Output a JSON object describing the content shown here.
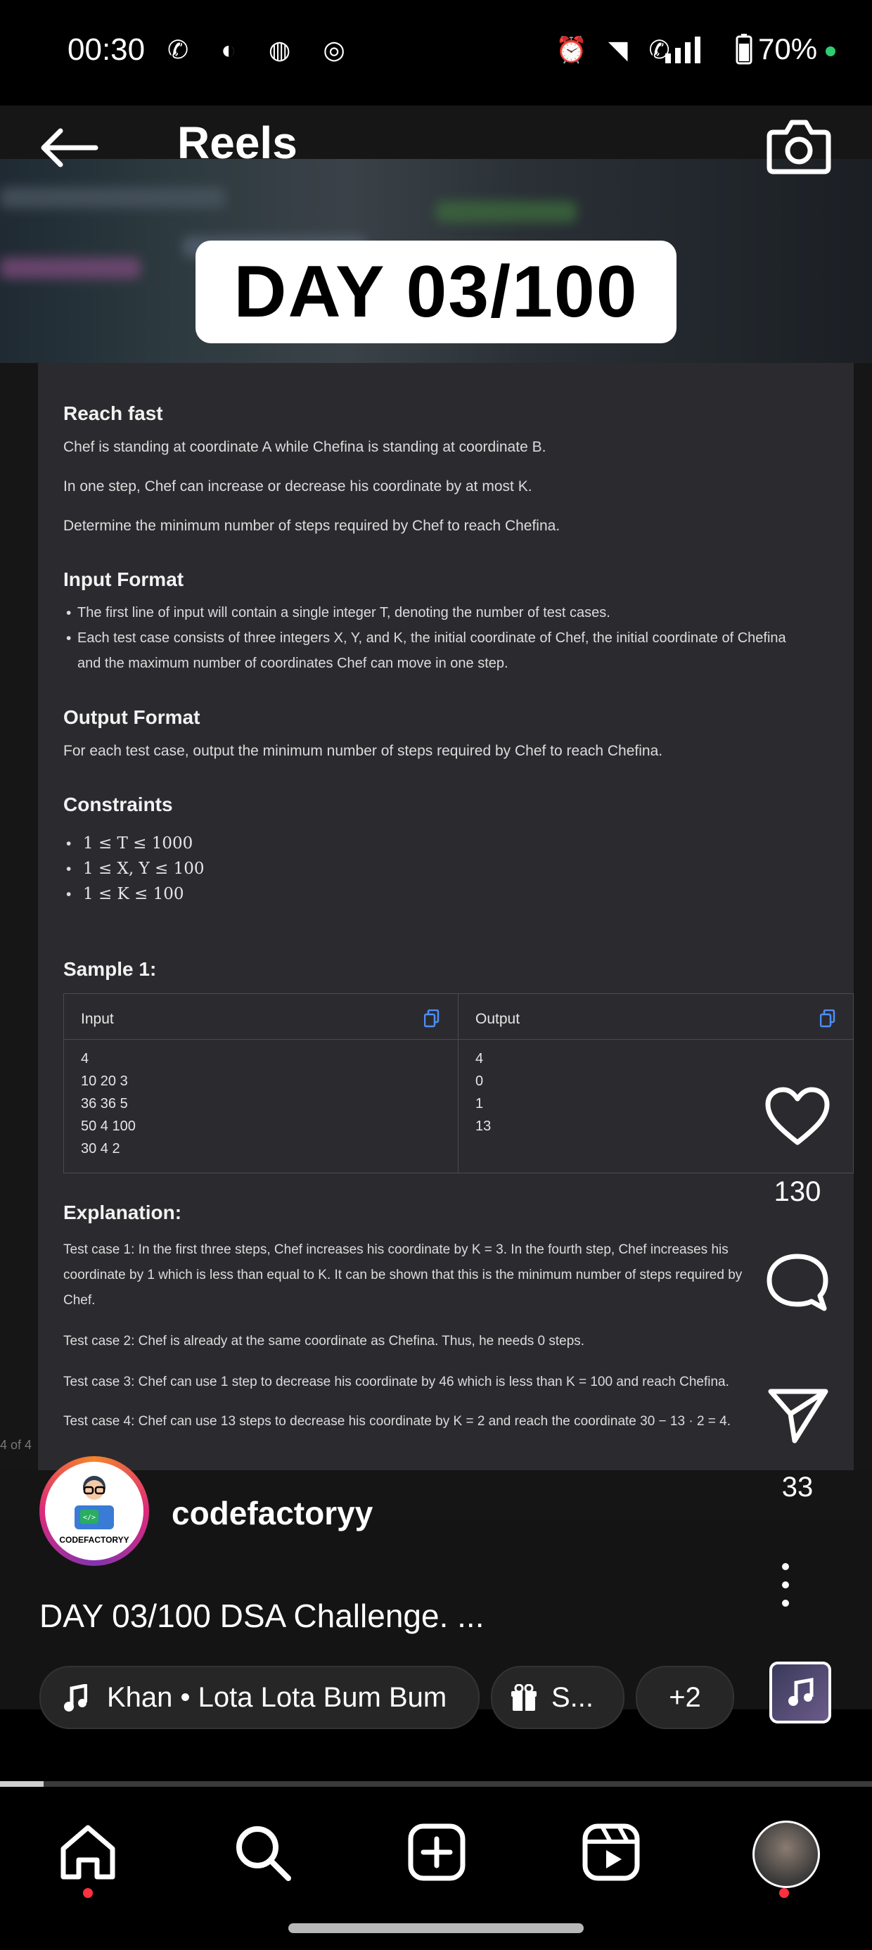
{
  "status_bar": {
    "time": "00:30",
    "left_icons": "✆ ◐ ◍ ◎",
    "right_icons": "⏰ ◥ ✆",
    "battery": "70%"
  },
  "header": {
    "title": "Reels"
  },
  "reel": {
    "day_title": "DAY 03/100",
    "problem": {
      "title": "Reach fast",
      "statement": [
        "Chef is standing at coordinate A while Chefina is standing at coordinate B.",
        "In one step, Chef can increase or decrease his coordinate by at most K.",
        "Determine the minimum number of steps required by Chef to reach Chefina."
      ],
      "input_heading": "Input Format",
      "input_bullets": [
        "The first line of input will contain a single integer T, denoting the number of test cases.",
        "Each test case consists of three integers X, Y, and K, the initial coordinate of Chef, the initial coordinate of Chefina",
        "and the maximum number of coordinates Chef can move in one step."
      ],
      "output_heading": "Output Format",
      "output_text": "For each test case, output the minimum number of steps required by Chef to reach Chefina.",
      "constraints_heading": "Constraints",
      "constraints": [
        "1 ≤ T ≤ 1000",
        "1 ≤ X, Y ≤ 100",
        "1 ≤ K ≤ 100"
      ],
      "sample_heading": "Sample 1:",
      "sample": {
        "input_label": "Input",
        "output_label": "Output",
        "input_rows": "4\n10 20 3\n36 36 5\n50 4 100\n30 4 2",
        "output_rows": "4\n0\n1\n13"
      },
      "explanation_heading": "Explanation:",
      "explanations": [
        "Test case 1: In the first three steps, Chef increases his coordinate by K = 3. In the fourth step, Chef increases his",
        "coordinate by 1 which is less than equal to K. It can be shown that this is the minimum number of steps required by",
        "Chef.",
        "Test case 2: Chef is already at the same coordinate as Chefina. Thus, he needs 0 steps.",
        "Test case 3: Chef can use 1 step to decrease his coordinate by 46 which is less than K = 100 and reach Chefina.",
        "Test case 4: Chef can use 13 steps to decrease his coordinate by K = 2 and reach the coordinate 30 − 13 · 2 = 4."
      ]
    },
    "page_indicator": "4 of 4"
  },
  "actions": {
    "likes": "130",
    "shares": "33"
  },
  "profile": {
    "username": "codefactoryy",
    "avatar_caption": "CODEFACTORYY",
    "caption": "DAY 03/100 DSA Challenge. ..."
  },
  "pills": {
    "audio": "Khan • Lota Lota Bum Bum",
    "gift": "S...",
    "more": "+2"
  },
  "progress": {
    "fraction": 0.05
  }
}
